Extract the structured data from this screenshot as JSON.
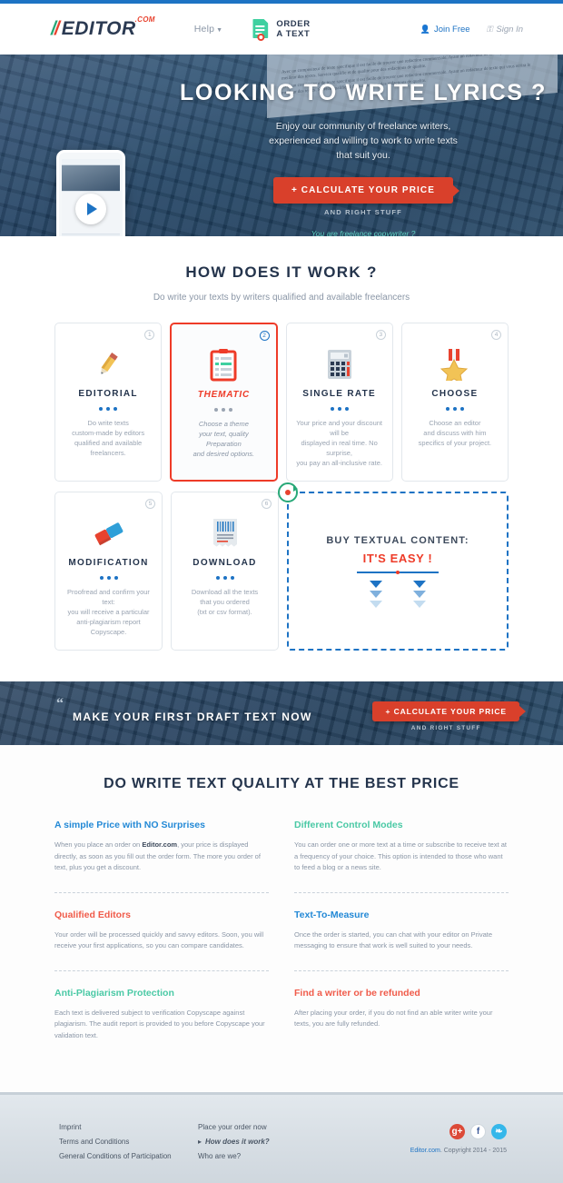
{
  "header": {
    "logo": {
      "slashes": "//",
      "word": "EDITOR",
      "tld": ".COM"
    },
    "help_label": "Help",
    "order_line1": "ORDER",
    "order_line2": "A TEXT",
    "join_label": "Join Free",
    "signin_label": "Sign In"
  },
  "hero": {
    "title": "LOOKING TO WRITE LYRICS ?",
    "subtitle_line1": "Enjoy our community of freelance writers,",
    "subtitle_line2": "experienced and willing to work to write texts",
    "subtitle_line3": "that suit you.",
    "cta_label": "+ CALCULATE YOUR PRICE",
    "cta_note": "AND RIGHT STUFF",
    "freelance_link": "You are freelance copywriter ?",
    "doc_text": "Avec un compositeur de texte specifique il est facile de trouver une redaction commerciale. Ayant un redacteur de texte qui vous ecrira le meilleur des textes. Service qualifie et de qualite pour des redactions de qualite."
  },
  "how": {
    "title": "HOW DOES IT WORK ?",
    "subtitle": "Do write your texts by writers qualified and available freelancers",
    "cards": [
      {
        "badge": "1",
        "icon": "pencil-icon",
        "title": "EDITORIAL",
        "desc_lines": [
          "Do write texts",
          "custom-made by editors",
          "qualified and available freelancers."
        ],
        "active": false
      },
      {
        "badge": "2",
        "icon": "clipboard-icon",
        "title": "THEMATIC",
        "desc_lines": [
          "Choose a theme",
          "your text, quality Preparation",
          "and desired options."
        ],
        "active": true
      },
      {
        "badge": "3",
        "icon": "calculator-icon",
        "title": "SINGLE RATE",
        "desc_lines": [
          "Your price and your discount will be",
          "displayed  in real time. No surprise,",
          "you pay an all-inclusive rate."
        ],
        "active": false
      },
      {
        "badge": "4",
        "icon": "medal-icon",
        "title": "CHOOSE",
        "desc_lines": [
          "Choose an editor",
          "and discuss with him",
          "specifics of your project."
        ],
        "active": false
      },
      {
        "badge": "5",
        "icon": "eraser-icon",
        "title": "MODIFICATION",
        "desc_lines": [
          "Proofread and confirm your text:",
          "you will receive a particular",
          "anti-plagiarism report Copyscape."
        ],
        "active": false
      },
      {
        "badge": "6",
        "icon": "barcode-receipt-icon",
        "title": "DOWNLOAD",
        "desc_lines": [
          "Download all the texts",
          "that you ordered",
          "(txt or csv format)."
        ],
        "active": false
      }
    ],
    "promo": {
      "line1": "BUY TEXTUAL CONTENT:",
      "line2": "IT'S EASY !",
      "icon": "refresh-circle-icon"
    }
  },
  "band": {
    "quote_mark": "“",
    "title": "MAKE YOUR FIRST DRAFT TEXT NOW",
    "cta_label": "+ CALCULATE YOUR PRICE",
    "cta_note": "AND RIGHT STUFF"
  },
  "quality": {
    "title": "DO WRITE TEXT QUALITY AT THE BEST PRICE",
    "items": [
      {
        "heading": "A simple Price with NO Surprises",
        "color": "#2389d6",
        "body_pre": "When you place an order on ",
        "body_strong": "Editor.com",
        "body_post": ", your price is displayed directly, as soon as you fill out the order form. The more you order of text, plus you get a discount."
      },
      {
        "heading": "Different Control Modes",
        "color": "#4ac9a5",
        "body_pre": "",
        "body_strong": "",
        "body_post": "You can order one or more text at a time or subscribe to receive text at a frequency of your choice. This option is intended to those who want to feed a blog or a news site."
      },
      {
        "heading": "Qualified Editors",
        "color": "#f05b4a",
        "body_pre": "",
        "body_strong": "",
        "body_post": "Your order will be processed quickly and savvy editors. Soon, you will receive your first applications, so you can compare candidates."
      },
      {
        "heading": "Text-To-Measure",
        "color": "#2389d6",
        "body_pre": "",
        "body_strong": "",
        "body_post": "Once the order is started, you can chat with your editor on Private messaging to ensure that work is well suited to your needs."
      },
      {
        "heading": "Anti-Plagiarism Protection",
        "color": "#4ac9a5",
        "body_pre": "",
        "body_strong": "",
        "body_post": "Each text is delivered subject to verification Copyscape against plagiarism. The audit report is provided to you before Copyscape your validation text."
      },
      {
        "heading": "Find a writer or be refunded",
        "color": "#f05b4a",
        "body_pre": "",
        "body_strong": "",
        "body_post": "After placing your order, if you do not find an able writer write your texts, you are fully refunded."
      }
    ]
  },
  "footer": {
    "col1": [
      "Imprint",
      "Terms and Conditions",
      "General Conditions of Participation"
    ],
    "col2_line1": "Place your order now",
    "col2_link": "How does it work?",
    "col2_line3": "Who are we?",
    "socials": [
      {
        "name": "google-plus-icon",
        "glyph": "g+"
      },
      {
        "name": "facebook-icon",
        "glyph": "f"
      },
      {
        "name": "twitter-icon",
        "glyph": "❧"
      }
    ],
    "copyright_brand": "Editor.com",
    "copyright_text": ". Copyright 2014 - 2015"
  }
}
